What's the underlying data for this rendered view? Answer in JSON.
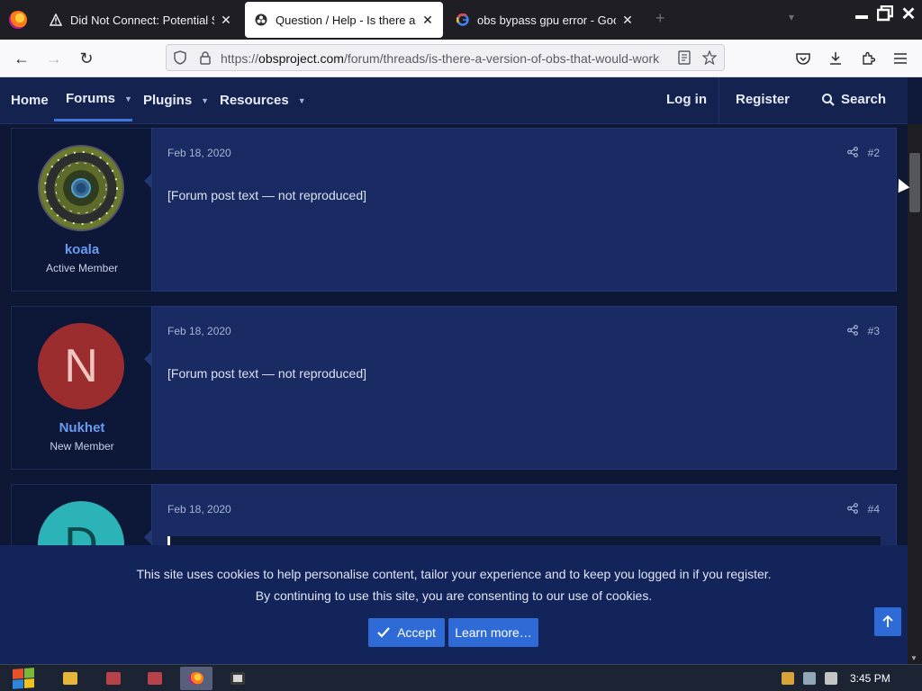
{
  "browser": {
    "tabs": [
      {
        "label": "Did Not Connect: Potential Security Issue",
        "icon": "warning-icon"
      },
      {
        "label": "Question / Help - Is there a version of OBS",
        "icon": "obs-icon",
        "active": true
      },
      {
        "label": "obs bypass gpu error - Google Search",
        "icon": "google-icon"
      }
    ],
    "new_tab": "+",
    "url_prefix": "https://",
    "url_domain": "obsproject.com",
    "url_path": "/forum/threads/is-there-a-version-of-obs-that-would-work"
  },
  "forum_nav": {
    "home": "Home",
    "forums": "Forums",
    "plugins": "Plugins",
    "resources": "Resources",
    "login": "Log in",
    "register": "Register",
    "search": "Search"
  },
  "posts": [
    {
      "user": "koala",
      "role": "Active Member",
      "date": "Feb 18, 2020",
      "number": "#2",
      "body": "[Forum post text — not reproduced]"
    },
    {
      "user": "Nukhet",
      "role": "New Member",
      "avatar_letter": "N",
      "date": "Feb 18, 2020",
      "number": "#3",
      "body": "[Forum post text — not reproduced]"
    },
    {
      "avatar_letter": "D",
      "date": "Feb 18, 2020",
      "number": "#4"
    }
  ],
  "cookie_banner": {
    "line1": "This site uses cookies to help personalise content, tailor your experience and to keep you logged in if you register.",
    "line2": "By continuing to use this site, you are consenting to our use of cookies.",
    "accept": "Accept",
    "learn_more": "Learn more…"
  },
  "taskbar": {
    "clock": "3:45 PM"
  },
  "colors": {
    "forum_bg": "#0e1835",
    "post_bg": "#1a2a63",
    "accent": "#2f6bd6",
    "username": "#6b9bf0"
  }
}
